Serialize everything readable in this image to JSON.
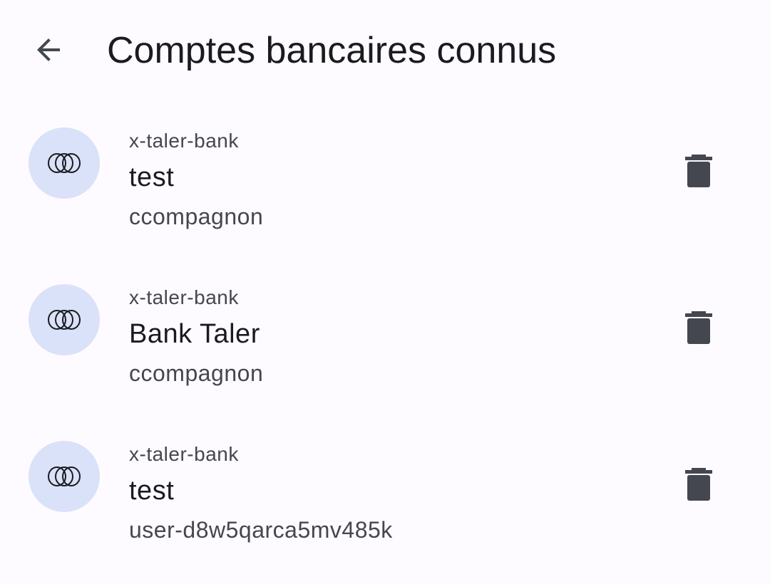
{
  "header": {
    "back_icon": "arrow-back-icon",
    "title": "Comptes bancaires connus"
  },
  "accounts": [
    {
      "type": "x-taler-bank",
      "name": "test",
      "user": "ccompagnon",
      "icon": "taler-rings-icon",
      "action_icon": "trash-icon"
    },
    {
      "type": "x-taler-bank",
      "name": "Bank Taler",
      "user": "ccompagnon",
      "icon": "taler-rings-icon",
      "action_icon": "trash-icon"
    },
    {
      "type": "x-taler-bank",
      "name": "test",
      "user": "user-d8w5qarca5mv485k",
      "icon": "taler-rings-icon",
      "action_icon": "trash-icon"
    }
  ],
  "colors": {
    "background": "#fdfbff",
    "avatar_bg": "#dae2f9",
    "icon": "#44474f",
    "text_primary": "#1b1b1f",
    "text_secondary": "#46464f"
  }
}
